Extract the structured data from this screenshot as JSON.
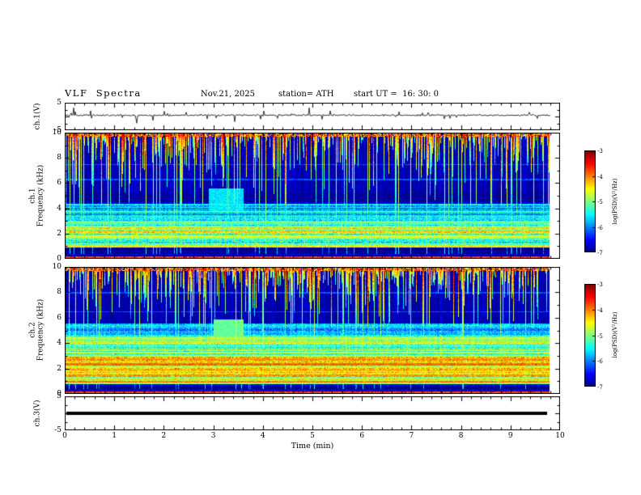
{
  "header": {
    "title": "VLF  Spectra",
    "date": "Nov.21, 2025",
    "station": "station= ATH",
    "start_ut": "start UT =  16: 30: 0"
  },
  "xaxis": {
    "label": "Time (min)",
    "min": 0,
    "max": 10,
    "major_ticks": [
      0,
      1,
      2,
      3,
      4,
      5,
      6,
      7,
      8,
      9,
      10
    ],
    "minor_per_major": 5,
    "data_end": 9.8
  },
  "colorbar": {
    "label": "log(PSD)(V²/Hz)",
    "min": -7,
    "max": -3,
    "ticks": [
      -3,
      -4,
      -5,
      -6,
      -7
    ]
  },
  "chart_data": [
    {
      "id": "wave1",
      "type": "line",
      "ylabel": "ch.1(V)",
      "ylim": [
        -5,
        5
      ],
      "ytick_labels": [
        5,
        -5
      ],
      "yticks_major": [
        -5,
        0,
        5
      ],
      "yticks_minor": [
        -2.5,
        2.5
      ],
      "gen": {
        "seed": 11,
        "mean": 0.45,
        "sigma": 0.32,
        "spike_prob": 0.06,
        "spike_min": 0.7
      }
    },
    {
      "id": "spec1",
      "type": "heatmap",
      "colormap": "jet",
      "ylabel_lines": [
        "ch.1",
        "Frequency (kHz)"
      ],
      "ylim": [
        0,
        10
      ],
      "ytick_labels": [
        0,
        2,
        4,
        6,
        8,
        10
      ],
      "yticks_major": [
        0,
        2,
        4,
        6,
        8,
        10
      ],
      "yticks_minor": [
        1,
        3,
        5,
        7,
        9
      ],
      "gen": {
        "seed": 42,
        "stripe_amp": 0.45,
        "stripe_fmax": 4.6,
        "bands": [
          [
            0,
            0.25,
            -4.2,
            1.1
          ],
          [
            0.25,
            0.9,
            -6.9,
            0.25
          ],
          [
            0.9,
            2.1,
            -5.2,
            0.7
          ],
          [
            2.1,
            2.6,
            -4.7,
            0.6
          ],
          [
            2.6,
            3.3,
            -5.4,
            0.6
          ],
          [
            3.3,
            4.4,
            -5.9,
            0.5
          ],
          [
            4.4,
            5.3,
            -6.9,
            0.2
          ],
          [
            5.3,
            10,
            -6.8,
            0.3
          ]
        ],
        "hlines": [
          [
            0.15,
            -3.8,
            0.1
          ],
          [
            1.0,
            -4.4,
            0.07
          ],
          [
            1.8,
            -4.6,
            0.07
          ],
          [
            2.2,
            -4.3,
            0.07
          ],
          [
            2.9,
            -5.0,
            0.06
          ],
          [
            3.4,
            -5.3,
            0.06
          ],
          [
            3.75,
            -5.3,
            0.06
          ],
          [
            4.1,
            -5.5,
            0.06
          ],
          [
            6.3,
            -6.2,
            0.05
          ],
          [
            7.5,
            -6.2,
            0.05
          ]
        ],
        "streak_density": 0.55,
        "streak_depth_scale": 1.7,
        "streak_fmin": 4.3,
        "streak_level_min": -5.9,
        "streak_level_span": 1.3,
        "deep_prob": 0.07,
        "topband_f": 9.72,
        "events": [
          [
            3.25,
            4.7,
            0.35,
            0.9,
            -5.6
          ]
        ]
      }
    },
    {
      "id": "spec2",
      "type": "heatmap",
      "colormap": "jet",
      "ylabel_lines": [
        "ch.2",
        "Frequency (kHz)"
      ],
      "ylim": [
        0,
        10
      ],
      "ytick_labels": [
        0,
        2,
        4,
        6,
        8,
        10
      ],
      "yticks_major": [
        0,
        2,
        4,
        6,
        8,
        10
      ],
      "yticks_minor": [
        1,
        3,
        5,
        7,
        9
      ],
      "gen": {
        "seed": 77,
        "stripe_amp": 0.5,
        "stripe_fmax": 5.6,
        "bands": [
          [
            0,
            0.25,
            -4.2,
            1.1
          ],
          [
            0.25,
            0.8,
            -6.9,
            0.25
          ],
          [
            0.8,
            1.4,
            -4.8,
            0.5
          ],
          [
            1.4,
            3.1,
            -4.5,
            0.6
          ],
          [
            3.1,
            4.6,
            -5.0,
            0.5
          ],
          [
            4.6,
            5.6,
            -5.6,
            0.5
          ],
          [
            5.6,
            10,
            -6.8,
            0.3
          ]
        ],
        "hlines": [
          [
            0.15,
            -3.8,
            0.1
          ],
          [
            1.0,
            -4.0,
            0.08
          ],
          [
            1.5,
            -4.1,
            0.08
          ],
          [
            1.9,
            -4.3,
            0.07
          ],
          [
            2.35,
            -3.9,
            0.08
          ],
          [
            2.75,
            -4.1,
            0.07
          ],
          [
            3.3,
            -4.7,
            0.06
          ],
          [
            4.0,
            -4.9,
            0.06
          ],
          [
            4.45,
            -5.0,
            0.06
          ],
          [
            6.5,
            -6.2,
            0.05
          ],
          [
            8.0,
            -6.2,
            0.05
          ]
        ],
        "streak_density": 0.55,
        "streak_depth_scale": 1.5,
        "streak_fmin": 5.3,
        "streak_level_min": -5.9,
        "streak_level_span": 1.3,
        "deep_prob": 0.06,
        "topband_f": 9.72,
        "events": [
          [
            3.3,
            5.0,
            0.3,
            0.9,
            -5.1
          ]
        ]
      }
    },
    {
      "id": "wave3",
      "type": "line",
      "ylabel": "ch.3(V)",
      "ylim": [
        -5,
        5
      ],
      "ytick_labels": [
        5,
        -5
      ],
      "yticks_major": [
        -5,
        0,
        5
      ],
      "yticks_minor": [
        -2.5,
        2.5
      ],
      "gen": {
        "seed": 7,
        "flat": true,
        "value": 0,
        "data_end": 9.75
      }
    }
  ]
}
